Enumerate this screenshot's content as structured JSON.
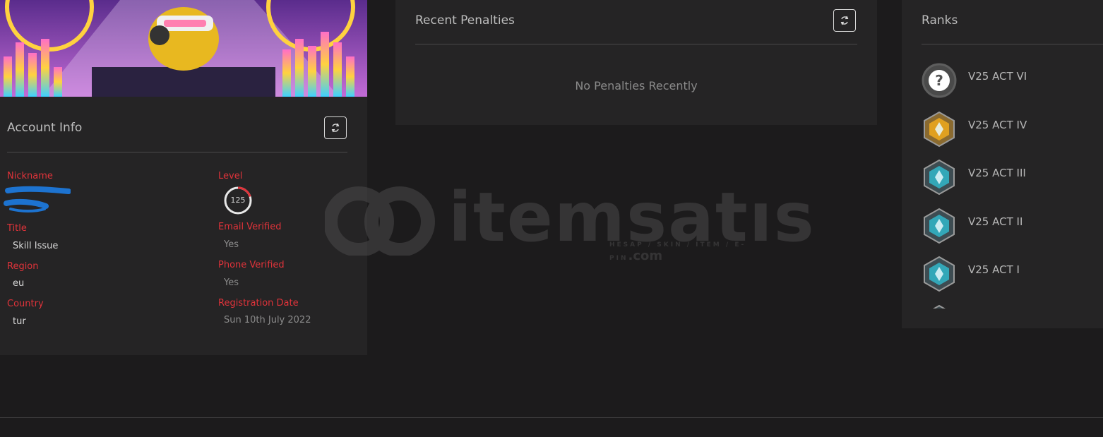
{
  "account": {
    "title": "Account Info",
    "fields": {
      "nickname_label": "Nickname",
      "title_label": "Title",
      "title_value": "Skill Issue",
      "region_label": "Region",
      "region_value": "eu",
      "country_label": "Country",
      "country_value": "tur",
      "level_label": "Level",
      "level_value": "125",
      "level_progress": 0.2,
      "email_label": "Email Verified",
      "email_value": "Yes",
      "phone_label": "Phone Verified",
      "phone_value": "Yes",
      "reg_label": "Registration Date",
      "reg_value": "Sun 10th July 2022"
    }
  },
  "penalties": {
    "title": "Recent Penalties",
    "empty_text": "No Penalties Recently"
  },
  "ranks": {
    "title": "Ranks",
    "items": [
      {
        "label": "V25 ACT VI",
        "icon": "unranked-icon"
      },
      {
        "label": "V25 ACT IV",
        "icon": "gold-rank-icon"
      },
      {
        "label": "V25 ACT III",
        "icon": "platinum-rank-icon"
      },
      {
        "label": "V25 ACT II",
        "icon": "platinum-rank-icon"
      },
      {
        "label": "V25 ACT I",
        "icon": "platinum-rank-icon"
      }
    ]
  },
  "watermark": {
    "text": "itemsatıs",
    "subtext": "HESAP / SKIN / ITEM / E-PIN",
    "domain": ".com"
  },
  "colors": {
    "accent": "#e0333a",
    "background": "#1c1b1c",
    "card": "#252425"
  }
}
